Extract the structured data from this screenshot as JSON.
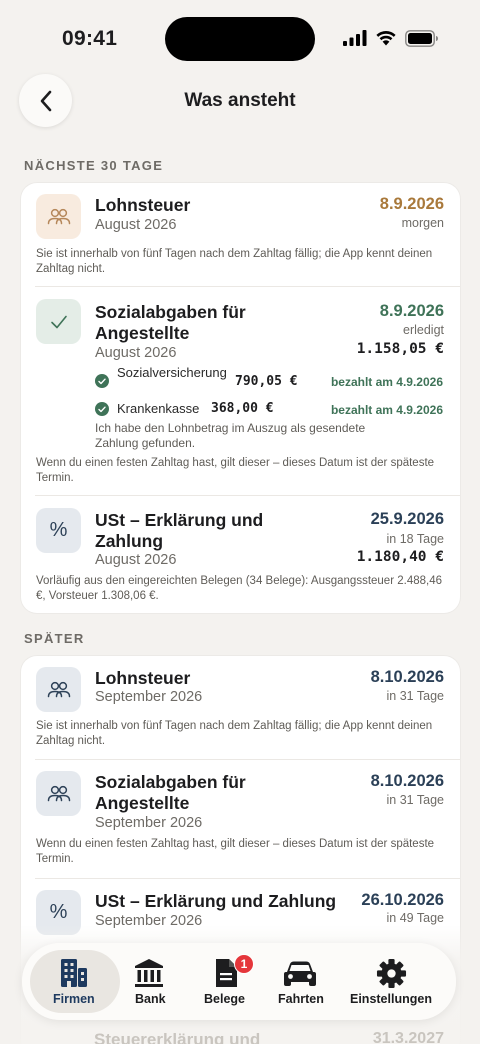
{
  "status": {
    "time": "09:41"
  },
  "header": {
    "title": "Was ansteht"
  },
  "sections": {
    "next": "NÄCHSTE 30 TAGE",
    "later": "SPÄTER"
  },
  "next_items": [
    {
      "title": "Lohnsteuer",
      "period": "August 2026",
      "date": "8.9.2026",
      "relative": "morgen",
      "note": "Sie ist innerhalb von fünf Tagen nach dem Zahltag fällig; die App kennt deinen Zahltag nicht.",
      "icon": "people-icon"
    },
    {
      "title": "Sozialabgaben für Angestellte",
      "period": "August 2026",
      "date": "8.9.2026",
      "relative": "erledigt",
      "amount": "1.158,05 €",
      "icon": "checkmark-icon",
      "payments": [
        {
          "label": "Sozialversicherung",
          "amount": "790,05 €",
          "status": "bezahlt am 4.9.2026"
        },
        {
          "label": "Krankenkasse",
          "amount": "368,00 €",
          "status": "bezahlt am 4.9.2026"
        }
      ],
      "payment_note": "Ich habe den Lohnbetrag im Auszug als gesendete Zahlung gefunden.",
      "note": "Wenn du einen festen Zahltag hast, gilt dieser – dieses Datum ist der späteste Termin."
    },
    {
      "title": "USt – Erklärung und Zahlung",
      "period": "August 2026",
      "date": "25.9.2026",
      "relative": "in 18 Tage",
      "amount": "1.180,40 €",
      "icon": "percent-icon",
      "icon_glyph": "%",
      "note": "Vorläufig aus den eingereichten Belegen (34 Belege): Ausgangssteuer 2.488,46 €, Vorsteuer 1.308,06 €."
    }
  ],
  "later_items": [
    {
      "title": "Lohnsteuer",
      "period": "September 2026",
      "date": "8.10.2026",
      "relative": "in 31 Tage",
      "note": "Sie ist innerhalb von fünf Tagen nach dem Zahltag fällig; die App kennt deinen Zahltag nicht.",
      "icon": "people-icon"
    },
    {
      "title": "Sozialabgaben für Angestellte",
      "period": "September 2026",
      "date": "8.10.2026",
      "relative": "in 31 Tage",
      "note": "Wenn du einen festen Zahltag hast, gilt dieser – dieses Datum ist der späteste Termin.",
      "icon": "people-icon"
    },
    {
      "title": "USt – Erklärung und Zahlung",
      "period": "September 2026",
      "date": "26.10.2026",
      "relative": "in 49 Tage",
      "icon": "percent-icon",
      "icon_glyph": "%"
    },
    {
      "title": "Steuererklärung und",
      "date": "31.3.2027"
    }
  ],
  "tabs": [
    {
      "label": "Firmen",
      "icon": "building-icon",
      "active": true
    },
    {
      "label": "Bank",
      "icon": "bank-icon"
    },
    {
      "label": "Belege",
      "icon": "document-icon",
      "badge": "1"
    },
    {
      "label": "Fahrten",
      "icon": "car-icon"
    },
    {
      "label": "Einstellungen",
      "icon": "gear-icon"
    }
  ],
  "colors": {
    "background": "#f4f2ef",
    "orange_date": "#a9793b",
    "green_date": "#3f7358",
    "navy_date": "#2b4057",
    "badge": "#e5363b"
  }
}
